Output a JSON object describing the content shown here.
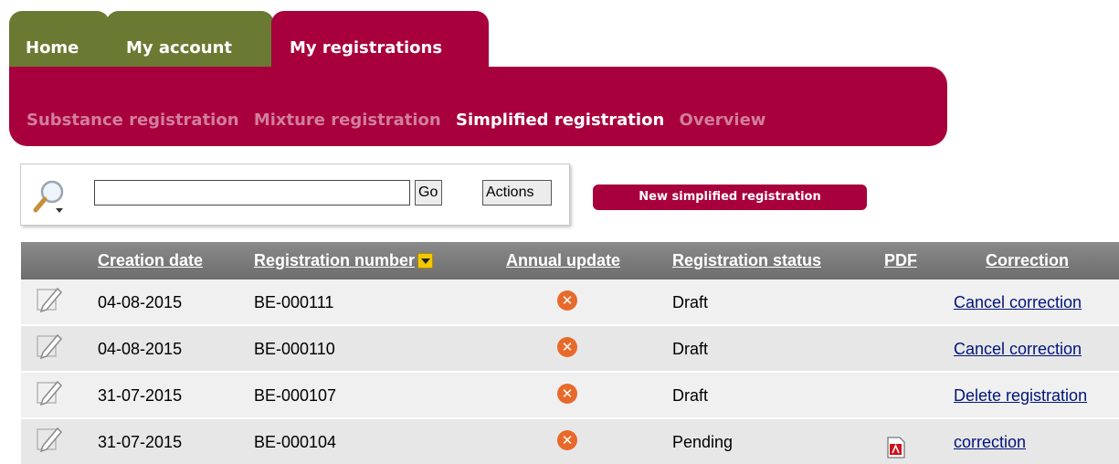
{
  "tabs": {
    "home": "Home",
    "my_account": "My account",
    "my_registrations": "My registrations"
  },
  "subnav": {
    "substance": "Substance registration",
    "mixture": "Mixture registration",
    "simplified": "Simplified registration",
    "overview": "Overview",
    "active": "simplified"
  },
  "search": {
    "value": "",
    "go_label": "Go",
    "actions_label": "Actions"
  },
  "new_button": "New simplified registration",
  "table": {
    "columns": {
      "creation_date": "Creation date",
      "registration_number": "Registration number",
      "annual_update": "Annual update",
      "registration_status": "Registration status",
      "pdf": "PDF",
      "correction": "Correction"
    },
    "sorted_by": "registration_number",
    "rows": [
      {
        "date": "04-08-2015",
        "number": "BE-000111",
        "annual_update": "x-icon",
        "status": "Draft",
        "pdf": false,
        "correction": "Cancel correction"
      },
      {
        "date": "04-08-2015",
        "number": "BE-000110",
        "annual_update": "x-icon",
        "status": "Draft",
        "pdf": false,
        "correction": "Cancel correction"
      },
      {
        "date": "31-07-2015",
        "number": "BE-000107",
        "annual_update": "x-icon",
        "status": "Draft",
        "pdf": false,
        "correction": "Delete registration"
      },
      {
        "date": "31-07-2015",
        "number": "BE-000104",
        "annual_update": "x-icon",
        "status": "Pending",
        "pdf": true,
        "correction": "correction"
      }
    ]
  },
  "colors": {
    "brand": "#a8003c",
    "tab_olive": "#6b7a32",
    "subnav_dim": "#d27e9d",
    "header_gray": "#7a7a7a",
    "row_odd": "#f0f0f0",
    "row_even": "#e7e7e7",
    "link": "#00147a",
    "x_icon": "#e86a2a"
  }
}
